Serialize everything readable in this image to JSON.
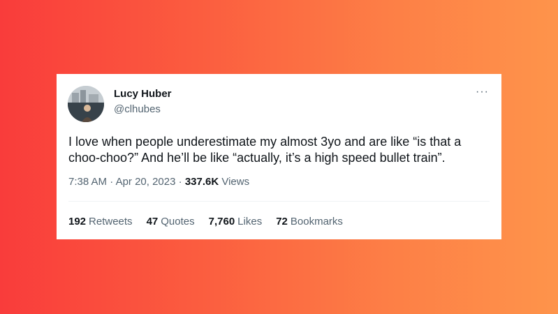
{
  "tweet": {
    "author_name": "Lucy Huber",
    "author_handle": "@clhubes",
    "more_icon": "···",
    "text": "I love when people underestimate my almost 3yo and are like “is that a choo-choo?” And he’ll be like “actually, it’s a high speed bullet train”.",
    "time": "7:38 AM",
    "separator": "·",
    "date": "Apr 20, 2023",
    "views_count": "337.6K",
    "views_label": "Views"
  },
  "stats": [
    {
      "num": "192",
      "label": "Retweets"
    },
    {
      "num": "47",
      "label": "Quotes"
    },
    {
      "num": "7,760",
      "label": "Likes"
    },
    {
      "num": "72",
      "label": "Bookmarks"
    }
  ],
  "colors": {
    "gradient_start": "#f93c3b",
    "gradient_end": "#fe944b",
    "text_primary": "#0f1419",
    "text_secondary": "#536471"
  }
}
